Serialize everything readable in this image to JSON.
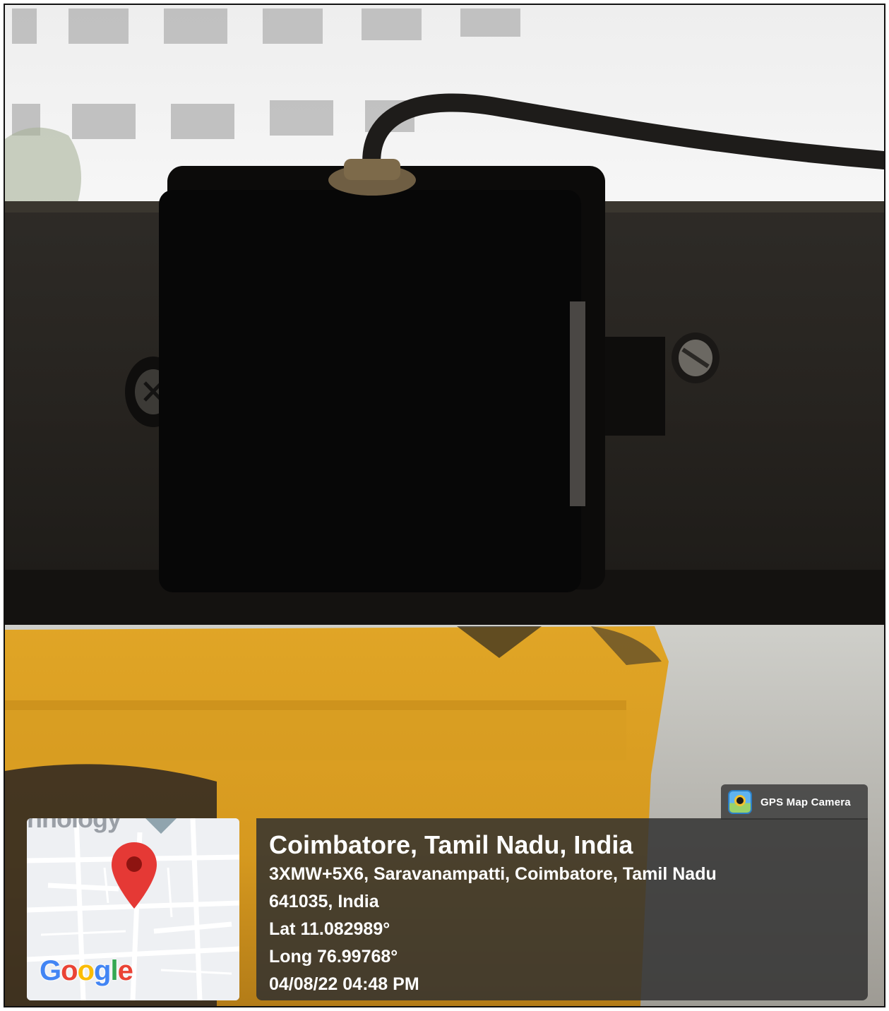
{
  "badge": {
    "label": "GPS Map Camera",
    "icon": "gps-map-camera-app-icon"
  },
  "map": {
    "partial_label": "nnology",
    "google_logo": [
      "G",
      "o",
      "o",
      "g",
      "l",
      "e"
    ],
    "google_colors": [
      "#4285F4",
      "#EA4335",
      "#FBBC05",
      "#4285F4",
      "#34A853",
      "#EA4335"
    ],
    "pin_color": "#E53935",
    "pin_icon": "map-pin-icon"
  },
  "info": {
    "title": "Coimbatore, Tamil Nadu, India",
    "address_line1": "3XMW+5X6, Saravanampatti, Coimbatore, Tamil Nadu",
    "address_line2": "641035, India",
    "latitude": "Lat 11.082989°",
    "longitude": "Long 76.99768°",
    "datetime": "04/08/22 04:48 PM"
  }
}
